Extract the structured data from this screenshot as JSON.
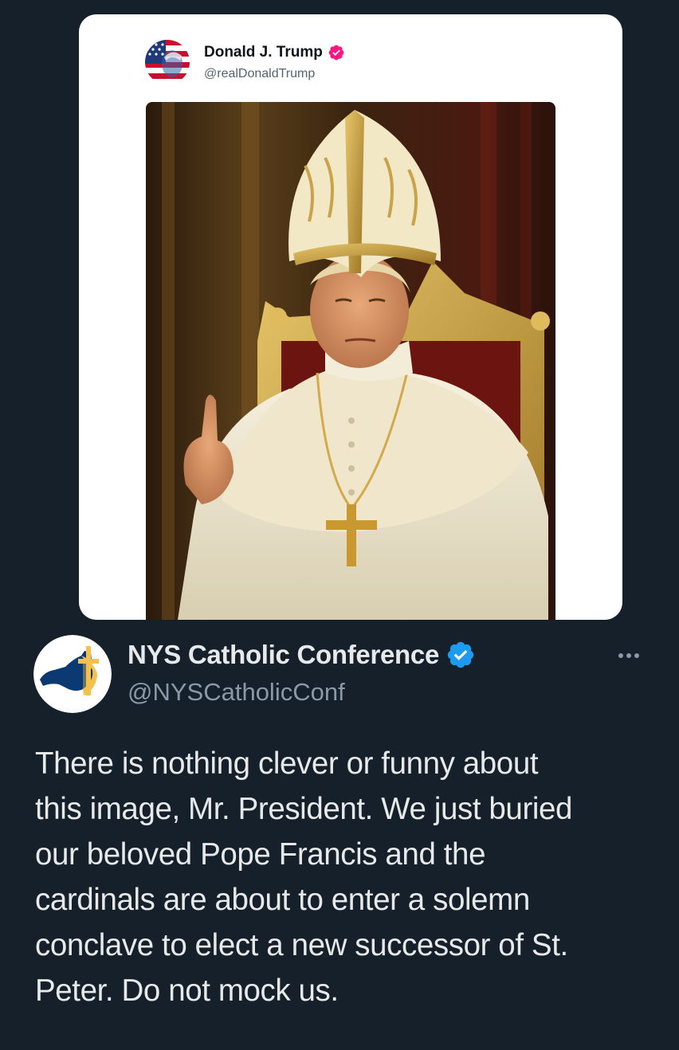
{
  "quoted_post": {
    "author_name": "Donald J. Trump",
    "author_handle": "@realDonaldTrump",
    "verified": true,
    "verified_badge_color": "#f91880",
    "avatar_icon": "american-flag-portrait-avatar",
    "media_icon": "ai-generated-pope-portrait-image"
  },
  "post": {
    "author_name": "NYS Catholic Conference",
    "author_handle": "@NYSCatholicConf",
    "verified": true,
    "verified_badge_color": "#1d9bf0",
    "avatar_icon": "new-york-state-cross-logo",
    "more_icon": "more-options-icon",
    "text": "There is nothing clever or funny about\nthis image, Mr. President. We just buried\nour beloved Pope Francis and the\ncardinals are about to enter a solemn\nconclave to elect a new successor of St.\nPeter. Do not mock us."
  },
  "colors": {
    "background": "#15202b",
    "primary_text": "#e7e9ea",
    "secondary_text": "#8b98a5",
    "card_background": "#ffffff"
  }
}
